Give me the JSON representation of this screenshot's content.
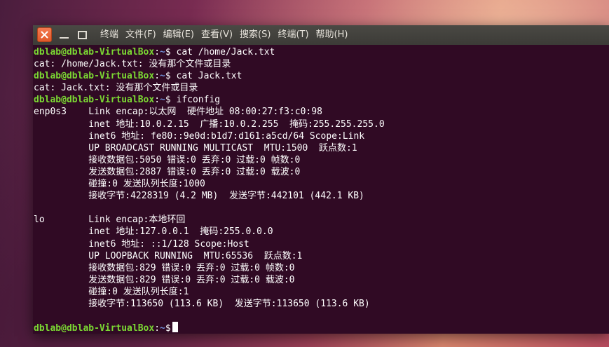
{
  "colors": {
    "terminal_bg": "#300a24",
    "prompt_user": "#7bd833",
    "prompt_path": "#6f8fd6",
    "text": "#ffffff",
    "titlebar": "#3c3b37",
    "close_button": "#e95420"
  },
  "window": {
    "buttons": {
      "close": "close-icon",
      "minimize": "minimize-icon",
      "maximize": "maximize-icon"
    },
    "menu": [
      "终端",
      "文件(F)",
      "编辑(E)",
      "查看(V)",
      "搜索(S)",
      "终端(T)",
      "帮助(H)"
    ]
  },
  "prompt": {
    "user_host": "dblab@dblab-VirtualBox",
    "colon": ":",
    "path": "~",
    "dollar": "$"
  },
  "lines": [
    {
      "type": "cmd",
      "command": " cat /home/Jack.txt"
    },
    {
      "type": "out",
      "text": "cat: /home/Jack.txt: 没有那个文件或目录"
    },
    {
      "type": "cmd",
      "command": " cat Jack.txt"
    },
    {
      "type": "out",
      "text": "cat: Jack.txt: 没有那个文件或目录"
    },
    {
      "type": "cmd",
      "command": " ifconfig"
    },
    {
      "type": "out",
      "text": "enp0s3    Link encap:以太网  硬件地址 08:00:27:f3:c0:98"
    },
    {
      "type": "out",
      "text": "          inet 地址:10.0.2.15  广播:10.0.2.255  掩码:255.255.255.0"
    },
    {
      "type": "out",
      "text": "          inet6 地址: fe80::9e0d:b1d7:d161:a5cd/64 Scope:Link"
    },
    {
      "type": "out",
      "text": "          UP BROADCAST RUNNING MULTICAST  MTU:1500  跃点数:1"
    },
    {
      "type": "out",
      "text": "          接收数据包:5050 错误:0 丢弃:0 过载:0 帧数:0"
    },
    {
      "type": "out",
      "text": "          发送数据包:2887 错误:0 丢弃:0 过载:0 载波:0"
    },
    {
      "type": "out",
      "text": "          碰撞:0 发送队列长度:1000"
    },
    {
      "type": "out",
      "text": "          接收字节:4228319 (4.2 MB)  发送字节:442101 (442.1 KB)"
    },
    {
      "type": "out",
      "text": ""
    },
    {
      "type": "out",
      "text": "lo        Link encap:本地环回"
    },
    {
      "type": "out",
      "text": "          inet 地址:127.0.0.1  掩码:255.0.0.0"
    },
    {
      "type": "out",
      "text": "          inet6 地址: ::1/128 Scope:Host"
    },
    {
      "type": "out",
      "text": "          UP LOOPBACK RUNNING  MTU:65536  跃点数:1"
    },
    {
      "type": "out",
      "text": "          接收数据包:829 错误:0 丢弃:0 过载:0 帧数:0"
    },
    {
      "type": "out",
      "text": "          发送数据包:829 错误:0 丢弃:0 过载:0 载波:0"
    },
    {
      "type": "out",
      "text": "          碰撞:0 发送队列长度:1"
    },
    {
      "type": "out",
      "text": "          接收字节:113650 (113.6 KB)  发送字节:113650 (113.6 KB)"
    },
    {
      "type": "out",
      "text": ""
    },
    {
      "type": "cmd",
      "command": "",
      "cursor": true
    }
  ]
}
